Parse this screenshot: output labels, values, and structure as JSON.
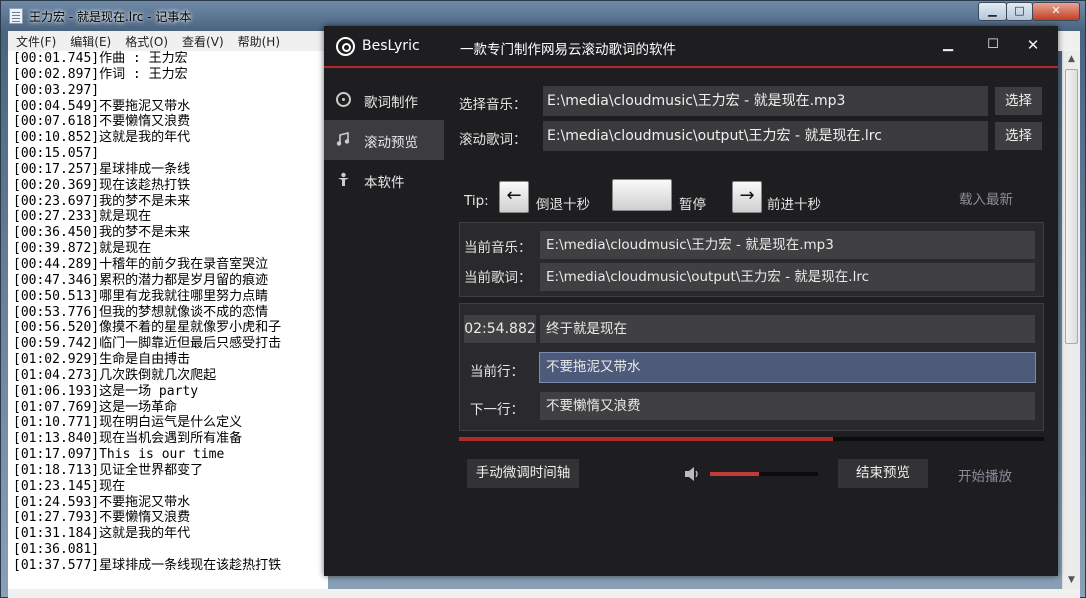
{
  "notepad": {
    "title": "王力宏 - 就是现在.lrc - 记事本",
    "controls": {
      "minimize": "▁",
      "maximize": "□",
      "close": "✕"
    },
    "menu": [
      "文件(F)",
      "编辑(E)",
      "格式(O)",
      "查看(V)",
      "帮助(H)"
    ],
    "lines": [
      "[00:01.745]作曲 : 王力宏",
      "[00:02.897]作词 : 王力宏",
      "[00:03.297]",
      "[00:04.549]不要拖泥又带水",
      "[00:07.618]不要懒惰又浪费",
      "[00:10.852]这就是我的年代",
      "[00:15.057]",
      "[00:17.257]星球排成一条线",
      "[00:20.369]现在该趁热打铁",
      "[00:23.697]我的梦不是未来",
      "[00:27.233]就是现在",
      "[00:36.450]我的梦不是未来",
      "[00:39.872]就是现在",
      "[00:44.289]十稽年的前夕我在录音室哭泣",
      "[00:47.346]累积的潜力都是岁月留的痕迹",
      "[00:50.513]哪里有龙我就往哪里努力点睛",
      "[00:53.776]但我的梦想就像谈不成的恋情",
      "[00:56.520]像摸不着的星星就像罗小虎和子",
      "[00:59.742]临门一脚靠近但最后只感受打击",
      "[01:02.929]生命是自由搏击",
      "[01:04.273]几次跌倒就几次爬起",
      "[01:06.193]这是一场 party",
      "[01:07.769]这是一场革命",
      "[01:10.771]现在明白运气是什么定义",
      "[01:13.840]现在当机会遇到所有准备",
      "[01:17.097]This is our time",
      "[01:18.713]见证全世界都变了",
      "[01:23.145]现在",
      "[01:24.593]不要拖泥又带水",
      "[01:27.793]不要懒惰又浪费",
      "[01:31.184]这就是我的年代",
      "[01:36.081]",
      "[01:37.577]星球排成一条线现在该趁热打铁"
    ]
  },
  "beslyric": {
    "app_name": "BesLyric",
    "slogan": "一款专门制作网易云滚动歌词的软件",
    "window_controls": {
      "minimize": "▁",
      "maximize": "☐",
      "close": "✕"
    },
    "sidebar": [
      {
        "label": "歌词制作",
        "icon": "disc-icon"
      },
      {
        "label": "滚动预览",
        "icon": "music-note-icon"
      },
      {
        "label": "本软件",
        "icon": "person-icon"
      }
    ],
    "select_music_label": "选择音乐：",
    "select_music_value": "E:\\media\\cloudmusic\\王力宏 - 就是现在.mp3",
    "scroll_lyric_label": "滚动歌词：",
    "scroll_lyric_value": "E:\\media\\cloudmusic\\output\\王力宏 - 就是现在.lrc",
    "select_button": "选择",
    "tip": {
      "label": "Tip:",
      "back_key": "←",
      "back_label": "倒退十秒",
      "pause_key": "",
      "pause_label": "暂停",
      "forward_key": "→",
      "forward_label": "前进十秒",
      "load_latest": "载入最新"
    },
    "current_music_label": "当前音乐：",
    "current_music_value": "E:\\media\\cloudmusic\\王力宏 - 就是现在.mp3",
    "current_lyric_label": "当前歌词：",
    "current_lyric_value": "E:\\media\\cloudmusic\\output\\王力宏 - 就是现在.lrc",
    "time": "02:54.882",
    "prev_line": "终于就是现在",
    "current_line_label": "当前行：",
    "current_line": "不要拖泥又带水",
    "next_line_label": "下一行：",
    "next_line": "不要懒惰又浪费",
    "progress": 0.64,
    "volume": 0.45,
    "manual_adjust_button": "手动微调时间轴",
    "end_preview_button": "结束预览",
    "start_play_link": "开始播放",
    "colors": {
      "accent_red": "#b12a2a",
      "highlight_blue": "#4e5a7a",
      "background": "#1e1e20"
    }
  }
}
